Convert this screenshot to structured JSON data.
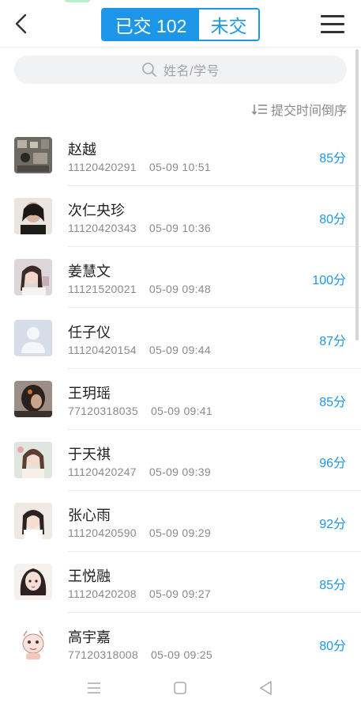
{
  "header": {
    "submitted_tab": "已交 102",
    "unsubmitted_tab": "未交"
  },
  "search": {
    "placeholder": "姓名/学号"
  },
  "sort": {
    "label": "提交时间倒序"
  },
  "students": [
    {
      "name": "赵越",
      "id": "11120420291",
      "time": "05-09 10:51",
      "score": "85分",
      "avatar": "photo-desk"
    },
    {
      "name": "次仁央珍",
      "id": "11120420343",
      "time": "05-09 10:36",
      "score": "80分",
      "avatar": "photo-portrait-dark"
    },
    {
      "name": "姜慧文",
      "id": "11121520021",
      "time": "05-09 09:48",
      "score": "100分",
      "avatar": "photo-portrait-light"
    },
    {
      "name": "任子仪",
      "id": "11120420154",
      "time": "05-09 09:44",
      "score": "87分",
      "avatar": "default-avatar"
    },
    {
      "name": "王玥瑶",
      "id": "77120318035",
      "time": "05-09 09:41",
      "score": "85分",
      "avatar": "photo-hair"
    },
    {
      "name": "于天祺",
      "id": "11120420247",
      "time": "05-09 09:39",
      "score": "96分",
      "avatar": "photo-girl-outdoor"
    },
    {
      "name": "张心雨",
      "id": "11120420590",
      "time": "05-09 09:29",
      "score": "92分",
      "avatar": "photo-girl-white"
    },
    {
      "name": "王悦融",
      "id": "11120420208",
      "time": "05-09 09:27",
      "score": "85分",
      "avatar": "illustrated-girl"
    },
    {
      "name": "高宇嘉",
      "id": "77120318008",
      "time": "05-09 09:25",
      "score": "80分",
      "avatar": "cartoon-character"
    }
  ],
  "colors": {
    "accent": "#1e96e8",
    "secondary_text": "#8a8a8a"
  }
}
